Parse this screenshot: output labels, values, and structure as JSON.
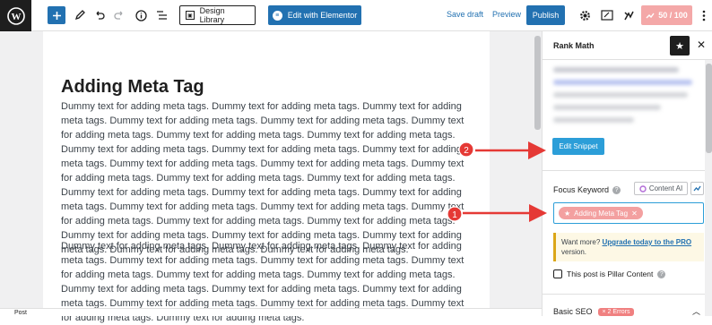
{
  "toolbar": {
    "logo_icon": "wordpress-logo",
    "design_library_label": "Design Library",
    "elementor_label": "Edit with Elementor",
    "save_draft_label": "Save draft",
    "preview_label": "Preview",
    "publish_label": "Publish",
    "seo_score": "50 / 100",
    "accent": "#2271b1"
  },
  "editor": {
    "title": "Adding Meta Tag",
    "paragraph1": "Dummy text for adding meta tags. Dummy text for adding meta tags. Dummy text for adding meta tags. Dummy text for adding meta tags. Dummy text for adding meta tags. Dummy text for adding meta tags. Dummy text for adding meta tags. Dummy text for adding meta tags. Dummy text for adding meta tags. Dummy text for adding meta tags. Dummy text for adding meta tags. Dummy text for adding meta tags. Dummy text for adding meta tags. Dummy text for adding meta tags. Dummy text for adding meta tags. Dummy text for adding meta tags. Dummy text for adding meta tags. Dummy text for adding meta tags. Dummy text for adding meta tags. Dummy text for adding meta tags. Dummy text for adding meta tags. Dummy text for adding meta tags. Dummy text for adding meta tags. Dummy text for adding meta tags. Dummy text for adding meta tags. Dummy text for adding meta tags. Dummy text for adding meta tags. Dummy text for adding meta tags. Dummy text for adding meta tags.",
    "paragraph2": "Dummy text for adding meta tags. Dummy text for adding meta tags. Dummy text for adding meta tags. Dummy text for adding meta tags. Dummy text for adding meta tags. Dummy text for adding meta tags. Dummy text for adding meta tags. Dummy text for adding meta tags. Dummy text for adding meta tags. Dummy text for adding meta tags. Dummy text for adding meta tags. Dummy text for adding meta tags. Dummy text for adding meta tags. Dummy text for adding meta tags. Dummy text for adding meta tags.",
    "footer_breadcrumb": "Post"
  },
  "sidebar": {
    "title": "Rank Math",
    "edit_snippet_label": "Edit Snippet",
    "focus_keyword_label": "Focus Keyword",
    "content_ai_label": "Content AI",
    "keyword_tag": "Adding Meta Tag",
    "upsell_prefix": "Want more?",
    "upsell_link": "Upgrade today to the PRO",
    "upsell_suffix": "version.",
    "pillar_label": "This post is Pillar Content",
    "basic_seo_label": "Basic SEO",
    "basic_seo_badge": "× 2 Errors"
  },
  "annotations": {
    "marker1": "1",
    "marker2": "2",
    "color": "#e53935"
  }
}
